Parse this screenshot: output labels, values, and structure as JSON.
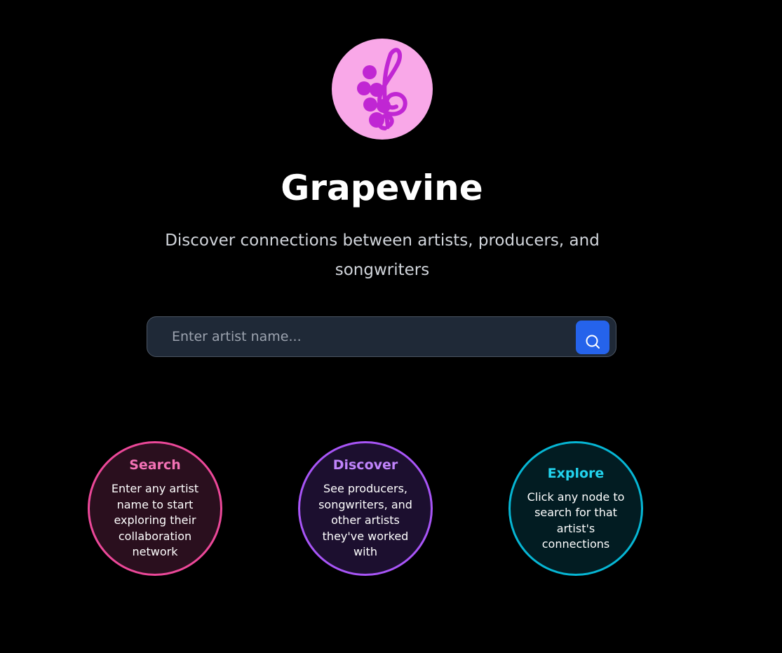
{
  "app": {
    "title": "Grapevine",
    "subtitle": "Discover connections between artists, producers, and songwriters",
    "logo_icon": "grape-treble-clef-icon"
  },
  "search": {
    "placeholder": "Enter artist name...",
    "value": "",
    "button_icon": "search-icon"
  },
  "features": [
    {
      "title": "Search",
      "text": "Enter any artist name to start exploring their collaboration network",
      "accent": "#ec4899"
    },
    {
      "title": "Discover",
      "text": "See producers, songwriters, and other artists they've worked with",
      "accent": "#a855f7"
    },
    {
      "title": "Explore",
      "text": "Click any node to search for that artist's connections",
      "accent": "#06b6d4"
    }
  ],
  "colors": {
    "background": "#000000",
    "logo_bg": "#f9a8e8",
    "logo_fg": "#c026d3",
    "search_button": "#2563eb"
  }
}
